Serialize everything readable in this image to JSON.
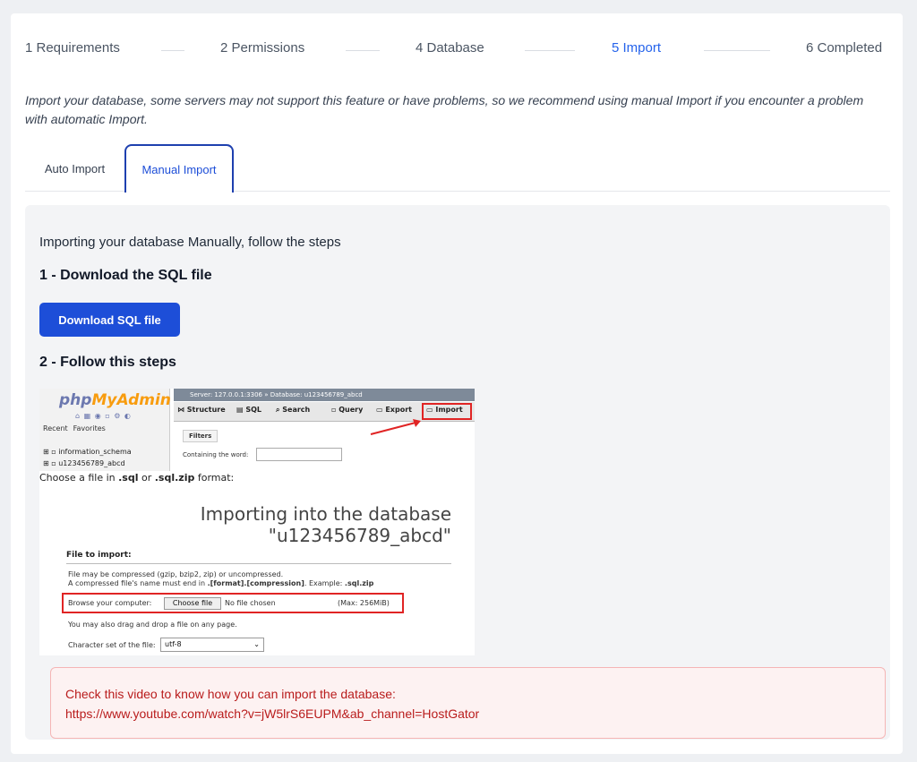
{
  "steps": [
    {
      "label": "1  Requirements",
      "active": false
    },
    {
      "label": "2  Permissions",
      "active": false
    },
    {
      "label": "4  Database",
      "active": false
    },
    {
      "label": "5  Import",
      "active": true
    },
    {
      "label": "6  Completed",
      "active": false
    }
  ],
  "intro": "Import your database, some servers may not support this feature or have problems, so we recommend using manual Import if you encounter a problem with automatic Import.",
  "tabs": {
    "auto_label": "Auto Import",
    "manual_label": "Manual Import",
    "active": "Manual Import"
  },
  "panel": {
    "intro": "Importing your database Manually, follow the steps",
    "step1_title": "1 - Download the SQL file",
    "download_label": "Download SQL file",
    "step2_title": "2 - Follow this steps"
  },
  "screenshot": {
    "logo_php": "php",
    "logo_my": "MyAdmin",
    "side_tabs": [
      "Recent",
      "Favorites"
    ],
    "databases": [
      "information_schema",
      "u123456789_abcd"
    ],
    "top_bar": "Server: 127.0.0.1:3306 » Database: u123456789_abcd",
    "nav": [
      "Structure",
      "SQL",
      "Search",
      "Query",
      "Export",
      "Import"
    ],
    "filters_label": "Filters",
    "containing_label": "Containing the word:",
    "choose_prefix": "Choose a file in ",
    "choose_fmt1": ".sql",
    "choose_or": " or ",
    "choose_fmt2": ".sql.zip",
    "choose_suffix": " format:",
    "import_title": "Importing into the database \"u123456789_abcd\"",
    "file_to_import": "File to import:",
    "desc_line1": "File may be compressed (gzip, bzip2, zip) or uncompressed.",
    "desc_line2_prefix": "A compressed file's name must end in ",
    "desc_line2_bold": ".[format].[compression]",
    "desc_line2_mid": ". Example: ",
    "desc_line2_example": ".sql.zip",
    "browse_label": "Browse your computer:",
    "browse_button": "Choose file",
    "browse_none": "No file chosen",
    "browse_max": "(Max: 256MiB)",
    "drag_text": "You may also drag and drop a file on any page.",
    "charset_label": "Character set of the file:",
    "charset_value": "utf-8"
  },
  "alert": {
    "line1": "Check this video to know how you can import the database:",
    "line2": "https://www.youtube.com/watch?v=jW5lrS6EUPM&ab_channel=HostGator"
  },
  "colors": {
    "accent": "#2563eb",
    "button": "#1d4ed8",
    "alert_text": "#b91c1c",
    "alert_bg": "#fdf2f2",
    "highlight_red": "#e02424"
  }
}
